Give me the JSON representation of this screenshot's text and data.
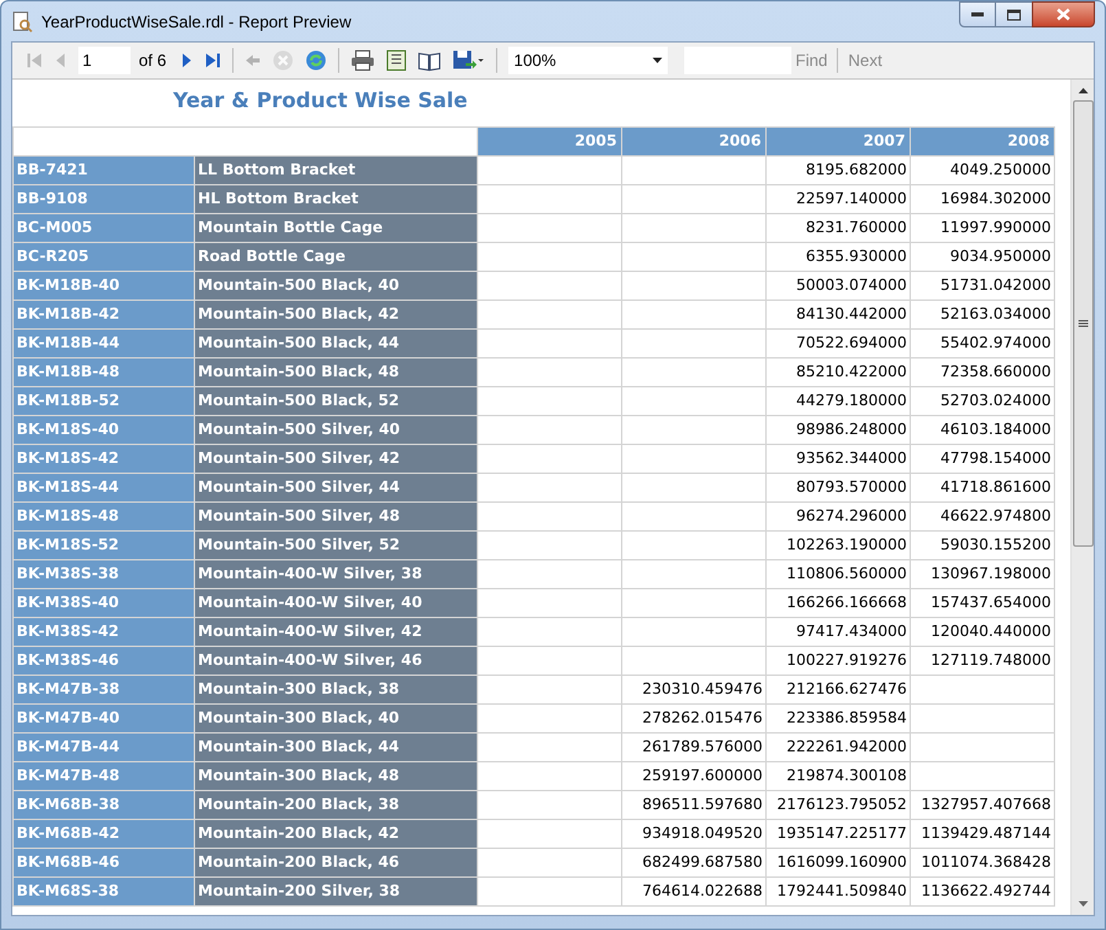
{
  "window": {
    "title": "YearProductWiseSale.rdl - Report Preview"
  },
  "toolbar": {
    "buttons": [
      {
        "kind": "first",
        "disabled": true
      },
      {
        "kind": "previous",
        "disabled": true
      },
      {
        "kind": "page_field",
        "value": "1"
      },
      {
        "kind": "page_count",
        "label": "of 6"
      },
      {
        "kind": "next",
        "disabled": false
      },
      {
        "kind": "last",
        "disabled": false
      },
      {
        "kind": "separator"
      },
      {
        "kind": "back",
        "disabled": true
      },
      {
        "kind": "stop",
        "disabled": true
      },
      {
        "kind": "refresh",
        "disabled": false
      },
      {
        "kind": "separator"
      },
      {
        "kind": "print",
        "disabled": false
      },
      {
        "kind": "print_layout",
        "disabled": false
      },
      {
        "kind": "page_setup",
        "disabled": false
      },
      {
        "kind": "export",
        "disabled": false
      },
      {
        "kind": "separator"
      },
      {
        "kind": "zoom",
        "value": "100%"
      },
      {
        "kind": "find_field"
      },
      {
        "kind": "find",
        "label": "Find",
        "disabled": true
      },
      {
        "kind": "separator"
      },
      {
        "kind": "find_next",
        "label": "Next",
        "disabled": true
      }
    ]
  },
  "report": {
    "title": "Year & Product Wise Sale",
    "columns": [
      "2005",
      "2006",
      "2007",
      "2008"
    ],
    "rows": [
      {
        "code": "BB-7421",
        "name": "LL Bottom Bracket",
        "values": {
          "col_3": "8195.682000",
          "col_4": "4049.250000"
        }
      },
      {
        "code": "BB-9108",
        "name": "HL Bottom Bracket",
        "values": {
          "col_3": "22597.140000",
          "col_4": "16984.302000"
        }
      },
      {
        "code": "BC-M005",
        "name": "Mountain Bottle Cage",
        "values": {
          "col_3": "8231.760000",
          "col_4": "11997.990000"
        }
      },
      {
        "code": "BC-R205",
        "name": "Road Bottle Cage",
        "values": {
          "col_3": "6355.930000",
          "col_4": "9034.950000"
        }
      },
      {
        "code": "BK-M18B-40",
        "name": "Mountain-500 Black, 40",
        "values": {
          "col_3": "50003.074000",
          "col_4": "51731.042000"
        }
      },
      {
        "code": "BK-M18B-42",
        "name": "Mountain-500 Black, 42",
        "values": {
          "col_3": "84130.442000",
          "col_4": "52163.034000"
        }
      },
      {
        "code": "BK-M18B-44",
        "name": "Mountain-500 Black, 44",
        "values": {
          "col_3": "70522.694000",
          "col_4": "55402.974000"
        }
      },
      {
        "code": "BK-M18B-48",
        "name": "Mountain-500 Black, 48",
        "values": {
          "col_3": "85210.422000",
          "col_4": "72358.660000"
        }
      },
      {
        "code": "BK-M18B-52",
        "name": "Mountain-500 Black, 52",
        "values": {
          "col_3": "44279.180000",
          "col_4": "52703.024000"
        }
      },
      {
        "code": "BK-M18S-40",
        "name": "Mountain-500 Silver, 40",
        "values": {
          "col_3": "98986.248000",
          "col_4": "46103.184000"
        }
      },
      {
        "code": "BK-M18S-42",
        "name": "Mountain-500 Silver, 42",
        "values": {
          "col_3": "93562.344000",
          "col_4": "47798.154000"
        }
      },
      {
        "code": "BK-M18S-44",
        "name": "Mountain-500 Silver, 44",
        "values": {
          "col_3": "80793.570000",
          "col_4": "41718.861600"
        }
      },
      {
        "code": "BK-M18S-48",
        "name": "Mountain-500 Silver, 48",
        "values": {
          "col_3": "96274.296000",
          "col_4": "46622.974800"
        }
      },
      {
        "code": "BK-M18S-52",
        "name": "Mountain-500 Silver, 52",
        "values": {
          "col_3": "102263.190000",
          "col_4": "59030.155200"
        }
      },
      {
        "code": "BK-M38S-38",
        "name": "Mountain-400-W Silver, 38",
        "values": {
          "col_3": "110806.560000",
          "col_4": "130967.198000"
        }
      },
      {
        "code": "BK-M38S-40",
        "name": "Mountain-400-W Silver, 40",
        "values": {
          "col_3": "166266.166668",
          "col_4": "157437.654000"
        }
      },
      {
        "code": "BK-M38S-42",
        "name": "Mountain-400-W Silver, 42",
        "values": {
          "col_3": "97417.434000",
          "col_4": "120040.440000"
        }
      },
      {
        "code": "BK-M38S-46",
        "name": "Mountain-400-W Silver, 46",
        "values": {
          "col_3": "100227.919276",
          "col_4": "127119.748000"
        }
      },
      {
        "code": "BK-M47B-38",
        "name": "Mountain-300 Black, 38",
        "values": {
          "col_2": "230310.459476",
          "col_3": "212166.627476"
        }
      },
      {
        "code": "BK-M47B-40",
        "name": "Mountain-300 Black, 40",
        "values": {
          "col_2": "278262.015476",
          "col_3": "223386.859584"
        }
      },
      {
        "code": "BK-M47B-44",
        "name": "Mountain-300 Black, 44",
        "values": {
          "col_2": "261789.576000",
          "col_3": "222261.942000"
        }
      },
      {
        "code": "BK-M47B-48",
        "name": "Mountain-300 Black, 48",
        "values": {
          "col_2": "259197.600000",
          "col_3": "219874.300108"
        }
      },
      {
        "code": "BK-M68B-38",
        "name": "Mountain-200 Black, 38",
        "values": {
          "col_2": "896511.597680",
          "col_3": "2176123.795052",
          "col_4": "1327957.407668"
        }
      },
      {
        "code": "BK-M68B-42",
        "name": "Mountain-200 Black, 42",
        "values": {
          "col_2": "934918.049520",
          "col_3": "1935147.225177",
          "col_4": "1139429.487144"
        }
      },
      {
        "code": "BK-M68B-46",
        "name": "Mountain-200 Black, 46",
        "values": {
          "col_2": "682499.687580",
          "col_3": "1616099.160900",
          "col_4": "1011074.368428"
        }
      },
      {
        "code": "BK-M68S-38",
        "name": "Mountain-200 Silver, 38",
        "values": {
          "col_2": "764614.022688",
          "col_3": "1792441.509840",
          "col_4": "1136622.492744"
        }
      }
    ]
  }
}
